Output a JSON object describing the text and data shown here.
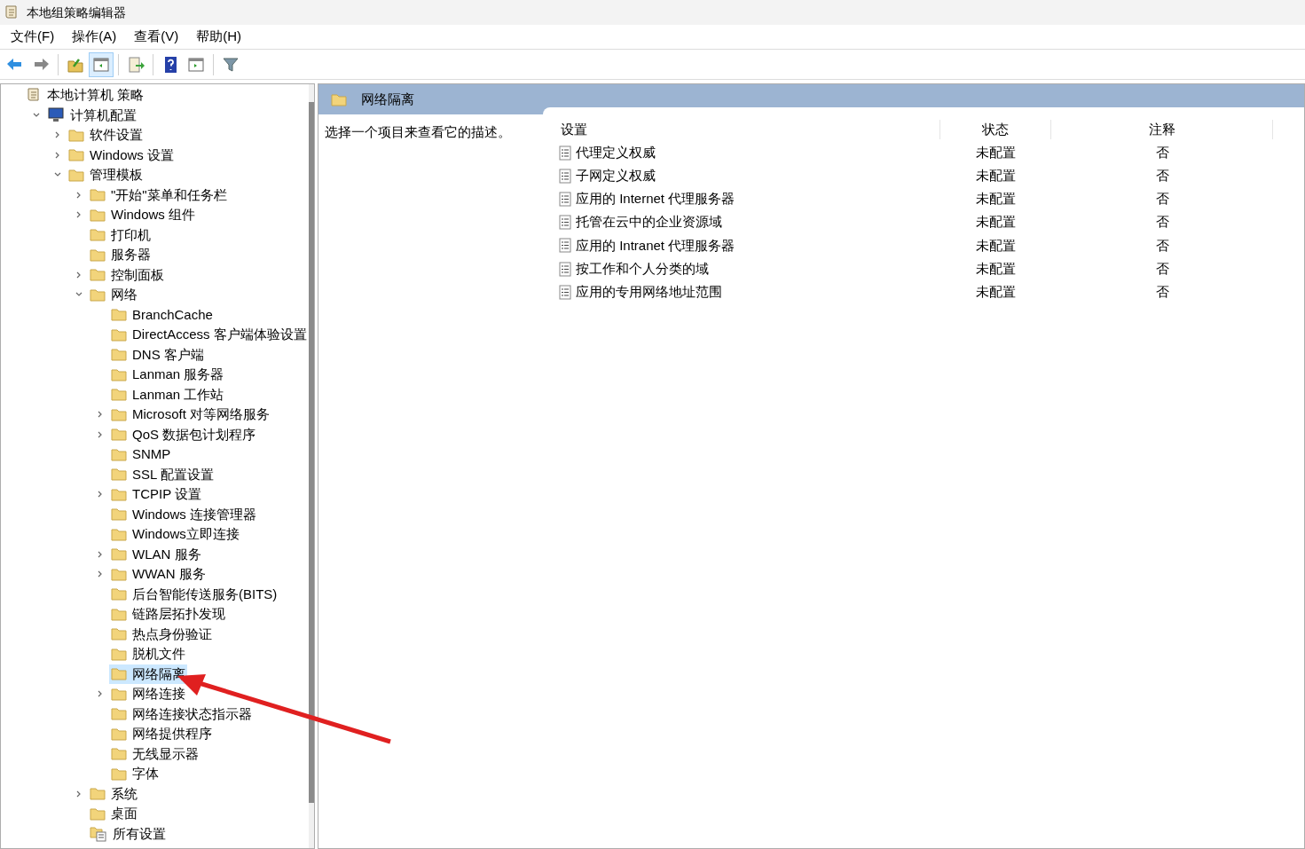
{
  "window": {
    "title": "本地组策略编辑器"
  },
  "menu": [
    "文件(F)",
    "操作(A)",
    "查看(V)",
    "帮助(H)"
  ],
  "toolbar": [
    {
      "kind": "back",
      "selected": false
    },
    {
      "kind": "forward",
      "selected": false
    },
    {
      "kind": "sep"
    },
    {
      "kind": "up",
      "selected": false
    },
    {
      "kind": "tree",
      "selected": true
    },
    {
      "kind": "sep"
    },
    {
      "kind": "export",
      "selected": false
    },
    {
      "kind": "sep"
    },
    {
      "kind": "help",
      "selected": false
    },
    {
      "kind": "view",
      "selected": false
    },
    {
      "kind": "sep"
    },
    {
      "kind": "filter",
      "selected": false
    }
  ],
  "tree": [
    {
      "label": "本地计算机 策略",
      "kind": "policy",
      "selected": false,
      "children": [
        {
          "label": "计算机配置",
          "kind": "computer",
          "expanded": true,
          "selected": false,
          "children": [
            {
              "label": "软件设置",
              "kind": "folder",
              "expanded": false,
              "selected": false
            },
            {
              "label": "Windows 设置",
              "kind": "folder",
              "expanded": false,
              "selected": false
            },
            {
              "label": "管理模板",
              "kind": "folder",
              "expanded": true,
              "selected": false,
              "children": [
                {
                  "label": "\"开始\"菜单和任务栏",
                  "kind": "folder",
                  "expanded": false,
                  "selected": false
                },
                {
                  "label": "Windows 组件",
                  "kind": "folder",
                  "expanded": false,
                  "selected": false
                },
                {
                  "label": "打印机",
                  "kind": "folder",
                  "selected": false
                },
                {
                  "label": "服务器",
                  "kind": "folder",
                  "selected": false
                },
                {
                  "label": "控制面板",
                  "kind": "folder",
                  "expanded": false,
                  "selected": false
                },
                {
                  "label": "网络",
                  "kind": "folder",
                  "expanded": true,
                  "selected": false,
                  "children": [
                    {
                      "label": "BranchCache",
                      "kind": "folder",
                      "selected": false
                    },
                    {
                      "label": "DirectAccess 客户端体验设置",
                      "kind": "folder",
                      "selected": false
                    },
                    {
                      "label": "DNS 客户端",
                      "kind": "folder",
                      "selected": false
                    },
                    {
                      "label": "Lanman 服务器",
                      "kind": "folder",
                      "selected": false
                    },
                    {
                      "label": "Lanman 工作站",
                      "kind": "folder",
                      "selected": false
                    },
                    {
                      "label": "Microsoft 对等网络服务",
                      "kind": "folder",
                      "expanded": false,
                      "selected": false
                    },
                    {
                      "label": "QoS 数据包计划程序",
                      "kind": "folder",
                      "expanded": false,
                      "selected": false
                    },
                    {
                      "label": "SNMP",
                      "kind": "folder",
                      "selected": false
                    },
                    {
                      "label": "SSL 配置设置",
                      "kind": "folder",
                      "selected": false
                    },
                    {
                      "label": "TCPIP 设置",
                      "kind": "folder",
                      "expanded": false,
                      "selected": false
                    },
                    {
                      "label": "Windows 连接管理器",
                      "kind": "folder",
                      "selected": false
                    },
                    {
                      "label": "Windows立即连接",
                      "kind": "folder",
                      "selected": false
                    },
                    {
                      "label": "WLAN 服务",
                      "kind": "folder",
                      "expanded": false,
                      "selected": false
                    },
                    {
                      "label": "WWAN 服务",
                      "kind": "folder",
                      "expanded": false,
                      "selected": false
                    },
                    {
                      "label": "后台智能传送服务(BITS)",
                      "kind": "folder",
                      "selected": false
                    },
                    {
                      "label": "链路层拓扑发现",
                      "kind": "folder",
                      "selected": false
                    },
                    {
                      "label": "热点身份验证",
                      "kind": "folder",
                      "selected": false
                    },
                    {
                      "label": "脱机文件",
                      "kind": "folder",
                      "selected": false
                    },
                    {
                      "label": "网络隔离",
                      "kind": "folder",
                      "selected": true
                    },
                    {
                      "label": "网络连接",
                      "kind": "folder",
                      "expanded": false,
                      "selected": false
                    },
                    {
                      "label": "网络连接状态指示器",
                      "kind": "folder",
                      "selected": false
                    },
                    {
                      "label": "网络提供程序",
                      "kind": "folder",
                      "selected": false
                    },
                    {
                      "label": "无线显示器",
                      "kind": "folder",
                      "selected": false
                    },
                    {
                      "label": "字体",
                      "kind": "folder",
                      "selected": false
                    }
                  ]
                },
                {
                  "label": "系统",
                  "kind": "folder",
                  "expanded": false,
                  "selected": false
                },
                {
                  "label": "桌面",
                  "kind": "folder",
                  "selected": false
                },
                {
                  "label": "所有设置",
                  "kind": "settings",
                  "selected": false
                }
              ]
            }
          ]
        }
      ]
    }
  ],
  "detail": {
    "title": "网络隔离",
    "description": "选择一个项目来查看它的描述。",
    "columns": [
      "设置",
      "状态",
      "注释"
    ],
    "rows": [
      {
        "setting": "代理定义权威",
        "state": "未配置",
        "comment": "否"
      },
      {
        "setting": "子网定义权威",
        "state": "未配置",
        "comment": "否"
      },
      {
        "setting": "应用的 Internet 代理服务器",
        "state": "未配置",
        "comment": "否"
      },
      {
        "setting": "托管在云中的企业资源域",
        "state": "未配置",
        "comment": "否"
      },
      {
        "setting": "应用的 Intranet 代理服务器",
        "state": "未配置",
        "comment": "否"
      },
      {
        "setting": "按工作和个人分类的域",
        "state": "未配置",
        "comment": "否"
      },
      {
        "setting": "应用的专用网络地址范围",
        "state": "未配置",
        "comment": "否"
      }
    ]
  }
}
